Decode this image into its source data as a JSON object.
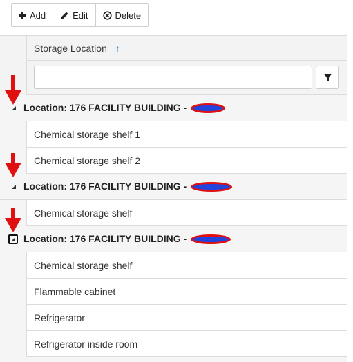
{
  "toolbar": {
    "add_label": "Add",
    "edit_label": "Edit",
    "delete_label": "Delete"
  },
  "grid": {
    "column_header": "Storage Location",
    "sort_icon": "arrow-up-icon",
    "filter": {
      "value": "",
      "placeholder": ""
    },
    "groups": [
      {
        "label": "Location: 176 FACILITY BUILDING -",
        "rows": [
          "Chemical storage shelf 1",
          "Chemical storage shelf 2"
        ]
      },
      {
        "label": "Location: 176 FACILITY BUILDING -",
        "rows": [
          "Chemical storage shelf"
        ]
      },
      {
        "label": "Location: 176 FACILITY BUILDING -",
        "rows": [
          "Chemical storage shelf",
          "Flammable cabinet",
          "Refrigerator",
          "Refrigerator inside room"
        ]
      }
    ]
  },
  "colors": {
    "annotation_arrow": "#e01010",
    "redaction_fill": "#2244dd",
    "redaction_outline": "#e01010",
    "sort_icon": "#3a8fd0"
  }
}
